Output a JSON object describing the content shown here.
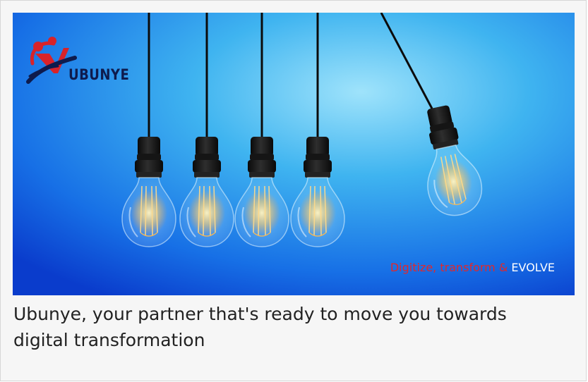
{
  "hero": {
    "logo_text": "UBUNYE",
    "slogan_part1": "Digitize, transform & ",
    "slogan_part2": "EVOLVE",
    "icon": "lightbulb-icon",
    "colors": {
      "sky_light": "#7fd4f5",
      "sky_dark": "#0b3fd1",
      "slogan_red": "#e0282c",
      "logo_navy": "#0e1b4d",
      "logo_red": "#d8232a"
    }
  },
  "caption": "Ubunye, your partner that's ready to move you towards digital transformation"
}
